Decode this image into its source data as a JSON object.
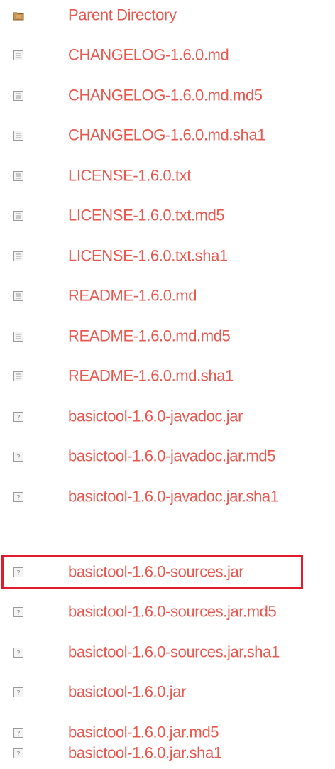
{
  "listing": {
    "entries": [
      {
        "name": "Parent Directory",
        "icon": "folder-icon"
      },
      {
        "name": "CHANGELOG-1.6.0.md",
        "icon": "text-file-icon"
      },
      {
        "name": "CHANGELOG-1.6.0.md.md5",
        "icon": "text-file-icon"
      },
      {
        "name": "CHANGELOG-1.6.0.md.sha1",
        "icon": "text-file-icon"
      },
      {
        "name": "LICENSE-1.6.0.txt",
        "icon": "text-file-icon"
      },
      {
        "name": "LICENSE-1.6.0.txt.md5",
        "icon": "text-file-icon"
      },
      {
        "name": "LICENSE-1.6.0.txt.sha1",
        "icon": "text-file-icon"
      },
      {
        "name": "README-1.6.0.md",
        "icon": "text-file-icon"
      },
      {
        "name": "README-1.6.0.md.md5",
        "icon": "text-file-icon"
      },
      {
        "name": "README-1.6.0.md.sha1",
        "icon": "text-file-icon"
      },
      {
        "name": "basictool-1.6.0-javadoc.jar",
        "icon": "unknown-file-icon"
      },
      {
        "name": "basictool-1.6.0-javadoc.jar.md5",
        "icon": "unknown-file-icon"
      },
      {
        "name": "basictool-1.6.0-javadoc.jar.sha1",
        "icon": "unknown-file-icon"
      },
      {
        "name": "basictool-1.6.0-sources.jar",
        "icon": "unknown-file-icon",
        "highlighted": true
      },
      {
        "name": "basictool-1.6.0-sources.jar.md5",
        "icon": "unknown-file-icon"
      },
      {
        "name": "basictool-1.6.0-sources.jar.sha1",
        "icon": "unknown-file-icon"
      },
      {
        "name": "basictool-1.6.0.jar",
        "icon": "unknown-file-icon"
      },
      {
        "name": "basictool-1.6.0.jar.md5",
        "icon": "unknown-file-icon"
      },
      {
        "name": "basictool-1.6.0.jar.sha1",
        "icon": "unknown-file-icon"
      }
    ]
  },
  "colors": {
    "link": "#e8584f",
    "highlight_border": "#e01d2a",
    "icon_gray": "#9a9a9a",
    "folder": "#b07a3a"
  }
}
